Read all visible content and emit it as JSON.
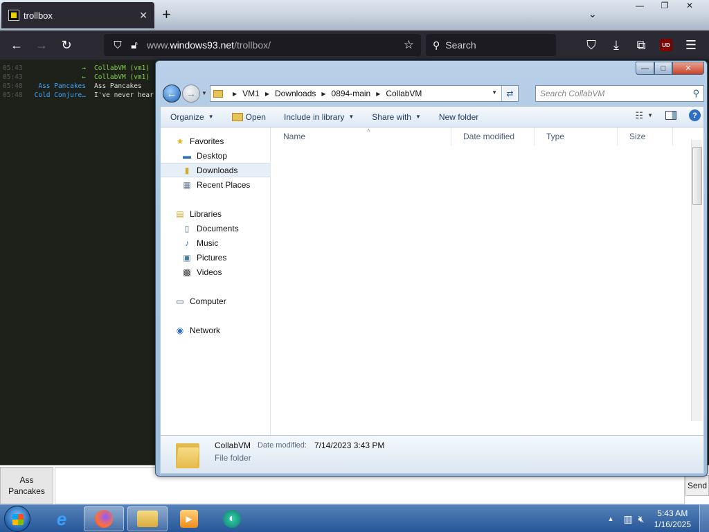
{
  "browser": {
    "tab": {
      "title": "trollbox",
      "close": "✕"
    },
    "new_tab": "+",
    "tab_list": "⌄",
    "window_controls": {
      "minimize": "—",
      "restore": "❐",
      "close": "✕"
    },
    "nav": {
      "back": "←",
      "forward": "→",
      "reload": "↻"
    },
    "url": {
      "host_prefix": "www.",
      "host": "windows93.net",
      "path": "/trollbox/"
    },
    "search_placeholder": "Search",
    "ublock_label": "UD"
  },
  "trollbox": {
    "messages": [
      {
        "time": "05:43",
        "nick": "→",
        "nick_color": "#7fd14a",
        "text": "CollabVM (vm1)",
        "text_color": "#7fd14a"
      },
      {
        "time": "05:43",
        "nick": "←",
        "nick_color": "#7fd14a",
        "text": "CollabVM (vm1)",
        "text_color": "#7fd14a"
      },
      {
        "time": "05:48",
        "nick": "Ass Pancakes",
        "nick_color": "#3ea6ff",
        "text": "Ass Pancakes",
        "text_color": "#dddddd"
      },
      {
        "time": "05:48",
        "nick": "Cold Conjure…",
        "nick_color": "#3ea6ff",
        "text": "I've never hear",
        "text_color": "#dddddd"
      }
    ],
    "nickname": "Ass Pancakes",
    "input_value": "",
    "send_label": "Send"
  },
  "explorer": {
    "window_buttons": {
      "minimize": "—",
      "maximize": "□",
      "close": "✕"
    },
    "address": {
      "crumbs": [
        "VM1",
        "Downloads",
        "0894-main",
        "CollabVM"
      ]
    },
    "search_placeholder": "Search CollabVM",
    "toolbar": {
      "organize": "Organize",
      "open": "Open",
      "include_in_library": "Include in library",
      "share_with": "Share with",
      "new_folder": "New folder"
    },
    "nav_pane": {
      "favorites": "Favorites",
      "desktop": "Desktop",
      "downloads": "Downloads",
      "recent_places": "Recent Places",
      "libraries": "Libraries",
      "documents": "Documents",
      "music": "Music",
      "pictures": "Pictures",
      "videos": "Videos",
      "computer": "Computer",
      "network": "Network",
      "selected": "downloads"
    },
    "columns": [
      "Name",
      "Date modified",
      "Type",
      "Size"
    ],
    "details": {
      "name": "CollabVM",
      "date_modified_label": "Date modified:",
      "date_modified": "7/14/2023 3:43 PM",
      "type": "File folder"
    }
  },
  "taskbar": {
    "clock_time": "5:43 AM",
    "clock_date": "1/16/2025"
  }
}
